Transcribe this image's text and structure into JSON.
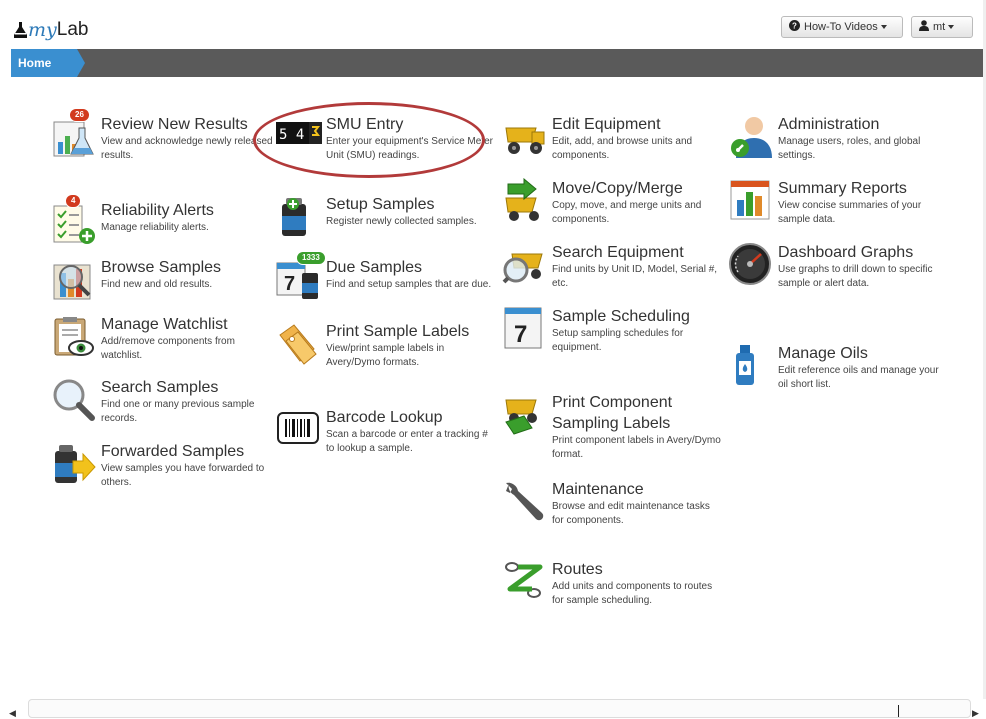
{
  "app": {
    "logo_my": "my",
    "logo_lab": "Lab"
  },
  "header": {
    "howto_label": "How-To Videos",
    "howto_icon": "question-circle-icon",
    "user_label": "mt",
    "user_icon": "user-icon"
  },
  "breadcrumb": {
    "home": "Home"
  },
  "tiles": [
    {
      "title": "Review New Results",
      "desc": "View and acknowledge newly released results.",
      "badge": "26",
      "icon": "flask-chart-icon"
    },
    {
      "title": "Reliability Alerts",
      "desc": "Manage reliability alerts.",
      "badge": "4",
      "icon": "checklist-add-icon"
    },
    {
      "title": "Browse Samples",
      "desc": "Find new and old results.",
      "icon": "browse-magnifier-icon"
    },
    {
      "title": "Manage Watchlist",
      "desc": "Add/remove components from watchlist.",
      "icon": "clipboard-eye-icon"
    },
    {
      "title": "Search Samples",
      "desc": "Find one or many previous sample records.",
      "icon": "magnifier-icon"
    },
    {
      "title": "Forwarded Samples",
      "desc": "View samples you have forwarded to others.",
      "icon": "forward-bottle-icon"
    },
    {
      "title": "SMU Entry",
      "desc": "Enter your equipment's Service Meter Unit (SMU) readings.",
      "icon": "odometer-icon",
      "counter": "5 4"
    },
    {
      "title": "Setup Samples",
      "desc": "Register newly collected samples.",
      "icon": "bottle-add-icon"
    },
    {
      "title": "Due Samples",
      "desc": "Find and setup samples that are due.",
      "badge": "1333",
      "icon": "calendar-bottle-icon",
      "cal_day": "7"
    },
    {
      "title": "Print Sample Labels",
      "desc": "View/print sample labels in Avery/Dymo formats.",
      "icon": "tags-icon"
    },
    {
      "title": "Barcode Lookup",
      "desc": "Scan a barcode or enter a tracking # to lookup a sample.",
      "icon": "barcode-icon"
    },
    {
      "title": "Edit Equipment",
      "desc": "Edit, add, and browse units and components.",
      "icon": "dump-truck-icon"
    },
    {
      "title": "Move/Copy/Merge",
      "desc": "Copy, move, and merge units and components.",
      "icon": "truck-arrow-icon"
    },
    {
      "title": "Search Equipment",
      "desc": "Find units by Unit ID, Model, Serial #, etc.",
      "icon": "truck-magnifier-icon"
    },
    {
      "title": "Sample Scheduling",
      "desc": "Setup sampling schedules for equipment.",
      "icon": "calendar-icon",
      "cal_day": "7"
    },
    {
      "title": "Print Component Sampling Labels",
      "desc": "Print component labels in Avery/Dymo format.",
      "icon": "truck-label-icon"
    },
    {
      "title": "Maintenance",
      "desc": "Browse and edit maintenance tasks for components.",
      "icon": "wrench-icon"
    },
    {
      "title": "Routes",
      "desc": "Add units and components to routes for sample scheduling.",
      "icon": "route-icon"
    },
    {
      "title": "Administration",
      "desc": "Manage users, roles, and global settings.",
      "icon": "admin-user-icon"
    },
    {
      "title": "Summary Reports",
      "desc": "View concise summaries of your sample data.",
      "icon": "report-chart-icon"
    },
    {
      "title": "Dashboard Graphs",
      "desc": "Use graphs to drill down to specific sample or alert data.",
      "icon": "gauge-icon"
    },
    {
      "title": "Manage Oils",
      "desc": "Edit reference oils and manage your oil short list.",
      "icon": "oil-bottle-icon"
    }
  ],
  "colors": {
    "accent": "#3a8fd0",
    "navbar": "#5a5a5a",
    "badge_red": "#d23a1e",
    "badge_green": "#3a9e2c",
    "highlight_circle": "#b23a3a"
  }
}
